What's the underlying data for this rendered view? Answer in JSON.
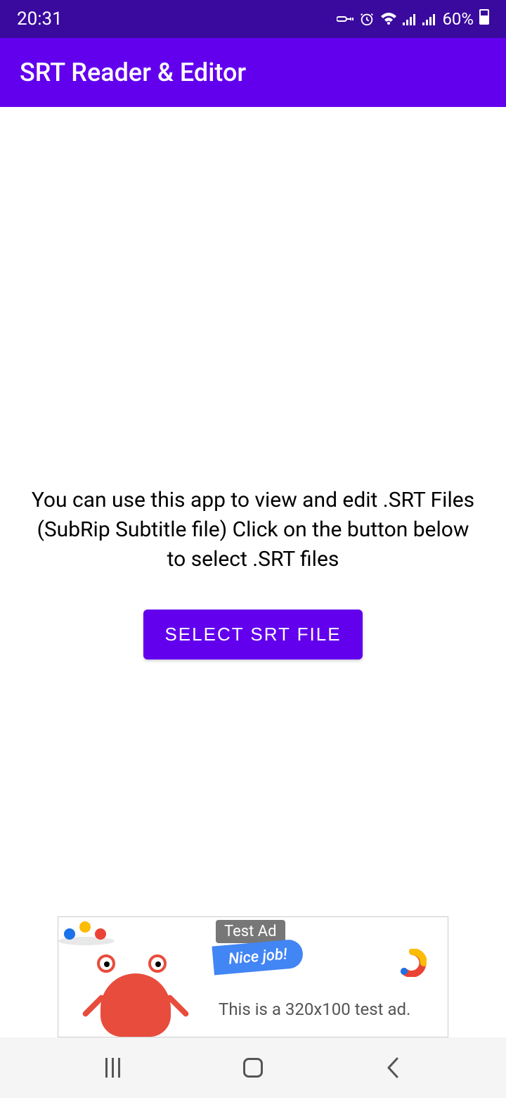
{
  "statusBar": {
    "time": "20:31",
    "battery": "60%"
  },
  "appBar": {
    "title": "SRT Reader & Editor"
  },
  "main": {
    "description": "You can use this app to view and edit .SRT Files (SubRip Subtitle file) Click on the button below to select .SRT files",
    "buttonLabel": "SELECT SRT FILE"
  },
  "ad": {
    "label": "Test Ad",
    "badge": "Nice job!",
    "text": "This is a 320x100 test ad."
  }
}
